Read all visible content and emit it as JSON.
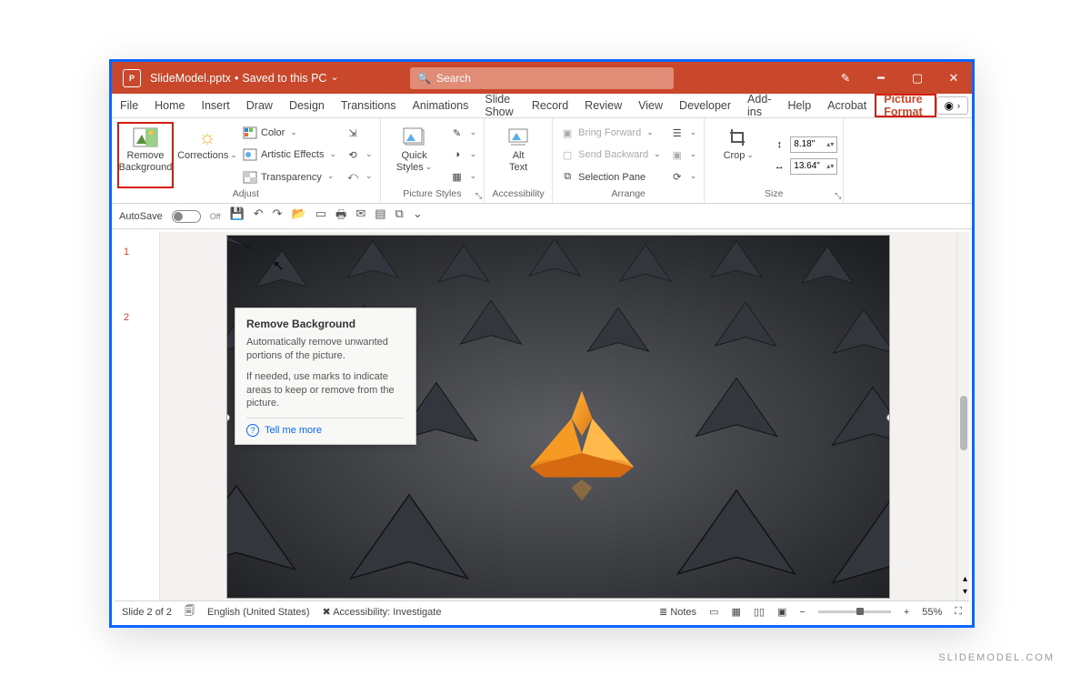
{
  "title": {
    "filename": "SlideModel.pptx",
    "save_state": "Saved to this PC"
  },
  "search": {
    "placeholder": "Search"
  },
  "tabs": [
    "File",
    "Home",
    "Insert",
    "Draw",
    "Design",
    "Transitions",
    "Animations",
    "Slide Show",
    "Record",
    "Review",
    "View",
    "Developer",
    "Add-ins",
    "Help",
    "Acrobat",
    "Picture Format"
  ],
  "ribbon": {
    "remove_bg": "Remove\nBackground",
    "corrections": "Corrections",
    "color": "Color",
    "artistic": "Artistic Effects",
    "transparency": "Transparency",
    "adjust_label": "Adjust",
    "quick_styles": "Quick\nStyles",
    "picture_styles_label": "Picture Styles",
    "alt_text": "Alt\nText",
    "accessibility_label": "Accessibility",
    "bring_fwd": "Bring Forward",
    "send_bwd": "Send Backward",
    "sel_pane": "Selection Pane",
    "arrange_label": "Arrange",
    "crop": "Crop",
    "height": "8.18\"",
    "width": "13.64\"",
    "size_label": "Size"
  },
  "qat": {
    "autosave": "AutoSave",
    "off": "Off"
  },
  "thumbs": [
    "1",
    "2"
  ],
  "tooltip": {
    "title": "Remove Background",
    "p1": "Automatically remove unwanted portions of the picture.",
    "p2": "If needed, use marks to indicate areas to keep or remove from the picture.",
    "tell": "Tell me more"
  },
  "status": {
    "slide": "Slide 2 of 2",
    "lang": "English (United States)",
    "access": "Accessibility: Investigate",
    "notes": "Notes",
    "zoom": "55%"
  },
  "watermark": "SLIDEMODEL.COM"
}
